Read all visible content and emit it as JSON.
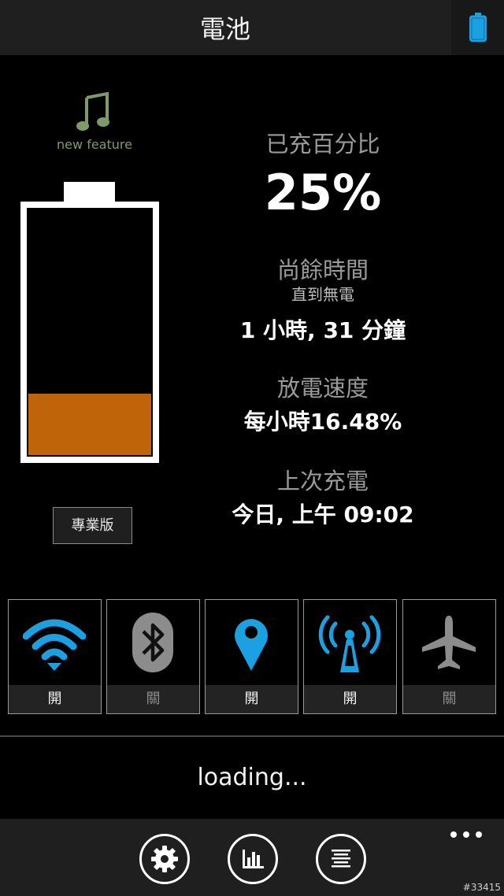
{
  "header": {
    "title": "電池"
  },
  "promo": {
    "new_feature_label": "new feature"
  },
  "battery": {
    "level_percent": 25,
    "fill_color": "#c0640a"
  },
  "pro_button_label": "專業版",
  "stats": {
    "charged_label": "已充百分比",
    "charged_value": "25%",
    "remaining_label": "尚餘時間",
    "remaining_sub": "直到無電",
    "remaining_value": "1 小時, 31 分鐘",
    "discharge_label": "放電速度",
    "discharge_value": "每小時16.48%",
    "last_charge_label": "上次充電",
    "last_charge_value": "今日, 上午 09:02"
  },
  "toggles": [
    {
      "name": "wifi",
      "icon": "wifi-icon",
      "state": "開",
      "on": true
    },
    {
      "name": "bluetooth",
      "icon": "bluetooth-icon",
      "state": "關",
      "on": false
    },
    {
      "name": "location",
      "icon": "location-pin-icon",
      "state": "開",
      "on": true
    },
    {
      "name": "cellular",
      "icon": "cellular-antenna-icon",
      "state": "開",
      "on": true
    },
    {
      "name": "airplane",
      "icon": "airplane-icon",
      "state": "關",
      "on": false
    }
  ],
  "loading_text": "loading...",
  "app_bar": {
    "buttons": [
      "settings-icon",
      "chart-icon",
      "list-icon"
    ],
    "more": "more-icon"
  },
  "watermark": "#33415",
  "colors": {
    "accent_blue": "#1ba1e2",
    "off_gray": "#8c8c8c",
    "music_green": "#7f9a66"
  }
}
